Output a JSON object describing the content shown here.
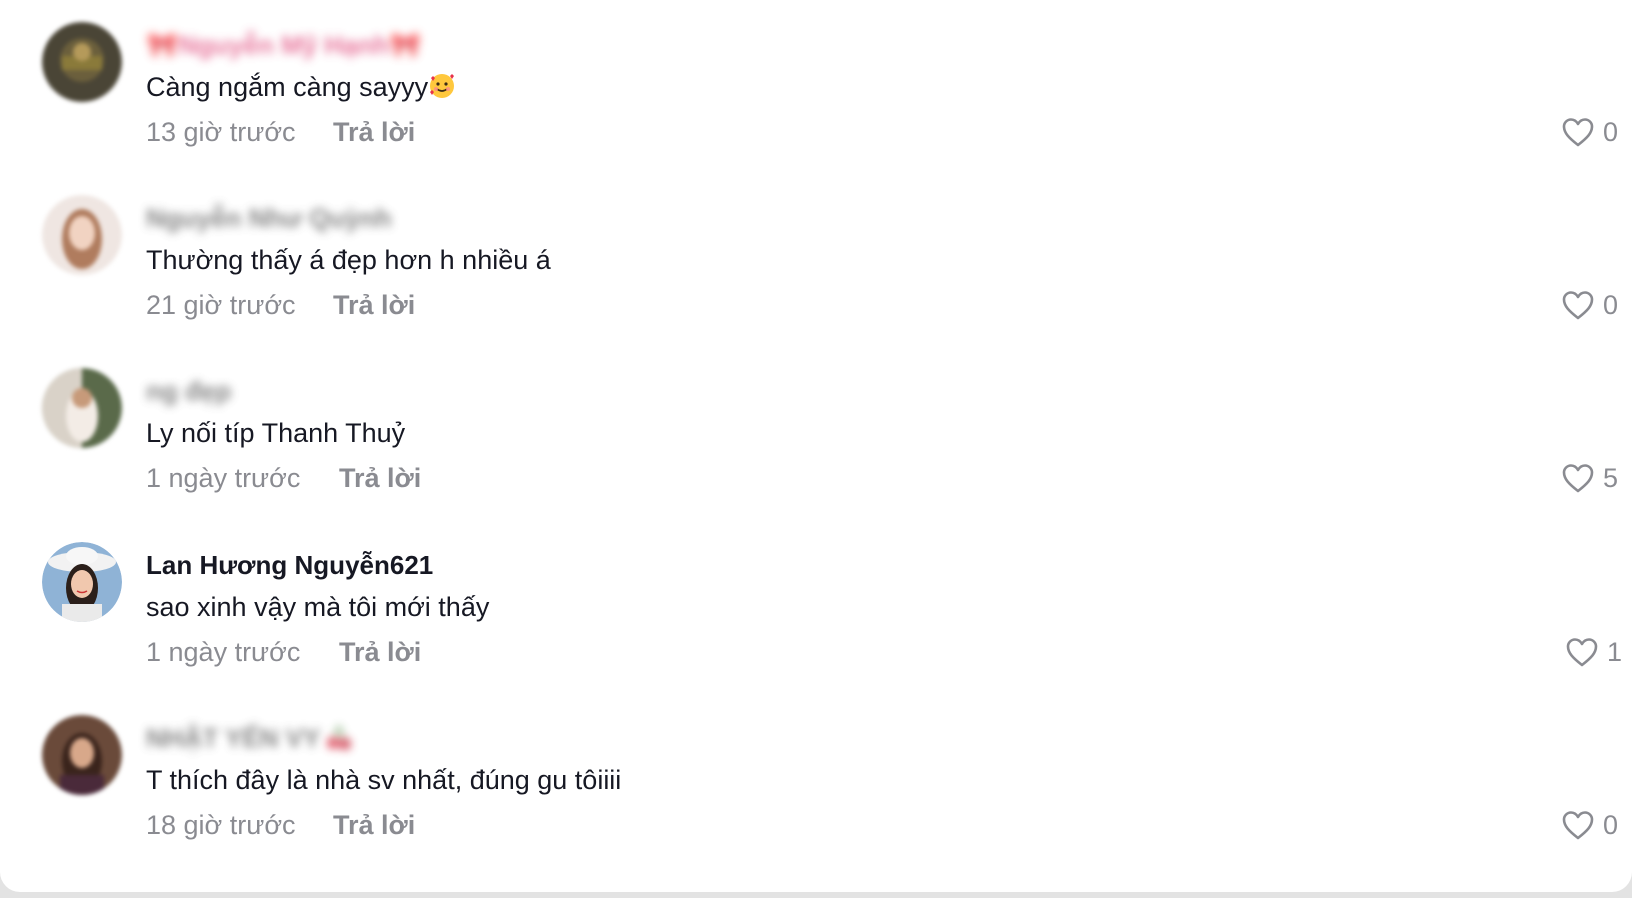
{
  "reply_label": "Trả lời",
  "colors": {
    "text_primary": "#161823",
    "text_secondary": "#8a8b91",
    "username_pink": "#e0477a"
  },
  "comments": [
    {
      "username": "🎀Nguyễn Mỹ Hạnh🎀",
      "username_blurred": true,
      "text": "Càng ngắm càng sayyy",
      "text_emoji": "smiling-face-with-hearts-icon",
      "time": "13 giờ trước",
      "likes": "0"
    },
    {
      "username": "Nguyễn Như Quỳnh",
      "username_blurred": true,
      "text": "Thường thấy á đẹp hơn h nhiều á",
      "time": "21 giờ trước",
      "likes": "0"
    },
    {
      "username": "ng đẹp",
      "username_blurred": true,
      "text": "Ly nối típ Thanh Thuỷ",
      "time": "1 ngày trước",
      "likes": "5"
    },
    {
      "username": "Lan Hương Nguyễn621",
      "username_blurred": false,
      "text": "sao xinh vậy mà tôi mới thấy",
      "time": "1 ngày trước",
      "likes": "1"
    },
    {
      "username": "NHẬT YẾN VY",
      "username_blurred": true,
      "username_emoji": "cherries-icon",
      "text": "T thích đây là nhà sv nhất, đúng gu tôiiii",
      "time": "18 giờ trước",
      "likes": "0"
    }
  ]
}
